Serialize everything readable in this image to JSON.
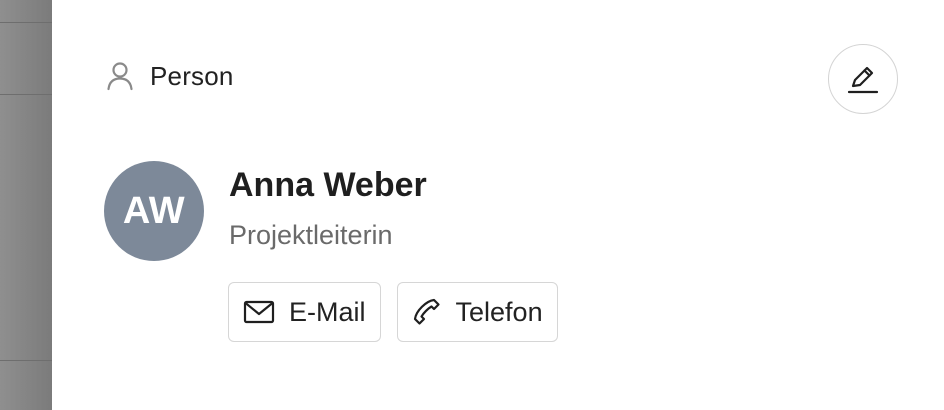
{
  "section": {
    "label": "Person",
    "icon": "person-icon"
  },
  "edit": {
    "icon": "pencil-icon"
  },
  "contact": {
    "initials": "AW",
    "name": "Anna Weber",
    "role": "Projektleiterin",
    "avatar_color": "#7d8999"
  },
  "actions": {
    "email_label": "E-Mail",
    "email_icon": "mail-icon",
    "phone_label": "Telefon",
    "phone_icon": "phone-icon"
  }
}
